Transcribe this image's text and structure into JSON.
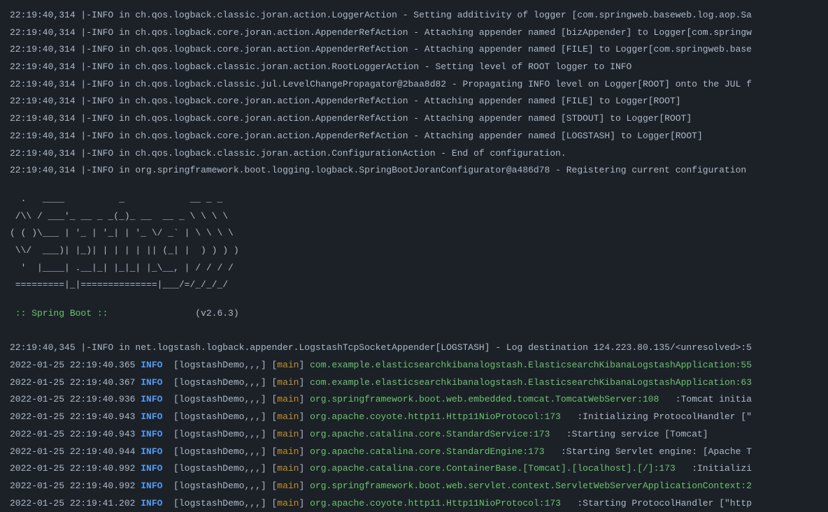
{
  "plainLogs": [
    "22:19:40,314 |-INFO in ch.qos.logback.classic.joran.action.LoggerAction - Setting additivity of logger [com.springweb.baseweb.log.aop.Sa",
    "22:19:40,314 |-INFO in ch.qos.logback.core.joran.action.AppenderRefAction - Attaching appender named [bizAppender] to Logger[com.springw",
    "22:19:40,314 |-INFO in ch.qos.logback.core.joran.action.AppenderRefAction - Attaching appender named [FILE] to Logger[com.springweb.base",
    "22:19:40,314 |-INFO in ch.qos.logback.classic.joran.action.RootLoggerAction - Setting level of ROOT logger to INFO",
    "22:19:40,314 |-INFO in ch.qos.logback.classic.jul.LevelChangePropagator@2baa8d82 - Propagating INFO level on Logger[ROOT] onto the JUL f",
    "22:19:40,314 |-INFO in ch.qos.logback.core.joran.action.AppenderRefAction - Attaching appender named [FILE] to Logger[ROOT]",
    "22:19:40,314 |-INFO in ch.qos.logback.core.joran.action.AppenderRefAction - Attaching appender named [STDOUT] to Logger[ROOT]",
    "22:19:40,314 |-INFO in ch.qos.logback.core.joran.action.AppenderRefAction - Attaching appender named [LOGSTASH] to Logger[ROOT]",
    "22:19:40,314 |-INFO in ch.qos.logback.classic.joran.action.ConfigurationAction - End of configuration.",
    "22:19:40,314 |-INFO in org.springframework.boot.logging.logback.SpringBootJoranConfigurator@a486d78 - Registering current configuration "
  ],
  "banner": "  .   ____          _            __ _ _\n /\\\\ / ___'_ __ _ _(_)_ __  __ _ \\ \\ \\ \\\n( ( )\\___ | '_ | '_| | '_ \\/ _` | \\ \\ \\ \\\n \\\\/  ___)| |_)| | | | | || (_| |  ) ) ) )\n  '  |____| .__|_| |_|_| |_\\__, | / / / /\n =========|_|==============|___/=/_/_/_/",
  "springBootTag": " :: Spring Boot :: ",
  "springBootVersion": "               (v2.6.3)",
  "logstashLine": "22:19:40,345 |-INFO in net.logstash.logback.appender.LogstashTcpSocketAppender[LOGSTASH] - Log destination 124.223.80.135/<unresolved>:5",
  "coloredLogs": [
    {
      "ts": "2022-01-25 22:19:40.365 ",
      "level": "INFO ",
      "app": " [logstashDemo,,,] [",
      "thread": "main",
      "logger": "com.example.elasticsearchkibanalogstash.ElasticsearchKibanaLogstashApplication:55"
    },
    {
      "ts": "2022-01-25 22:19:40.367 ",
      "level": "INFO ",
      "app": " [logstashDemo,,,] [",
      "thread": "main",
      "logger": "com.example.elasticsearchkibanalogstash.ElasticsearchKibanaLogstashApplication:63"
    },
    {
      "ts": "2022-01-25 22:19:40.936 ",
      "level": "INFO ",
      "app": " [logstashDemo,,,] [",
      "thread": "main",
      "logger": "org.springframework.boot.web.embedded.tomcat.TomcatWebServer:108",
      "msg": "   :Tomcat initia"
    },
    {
      "ts": "2022-01-25 22:19:40.943 ",
      "level": "INFO ",
      "app": " [logstashDemo,,,] [",
      "thread": "main",
      "logger": "org.apache.coyote.http11.Http11NioProtocol:173",
      "msg": "   :Initializing ProtocolHandler [\""
    },
    {
      "ts": "2022-01-25 22:19:40.943 ",
      "level": "INFO ",
      "app": " [logstashDemo,,,] [",
      "thread": "main",
      "logger": "org.apache.catalina.core.StandardService:173",
      "msg": "   :Starting service [Tomcat]"
    },
    {
      "ts": "2022-01-25 22:19:40.944 ",
      "level": "INFO ",
      "app": " [logstashDemo,,,] [",
      "thread": "main",
      "logger": "org.apache.catalina.core.StandardEngine:173",
      "msg": "   :Starting Servlet engine: [Apache T"
    },
    {
      "ts": "2022-01-25 22:19:40.992 ",
      "level": "INFO ",
      "app": " [logstashDemo,,,] [",
      "thread": "main",
      "logger": "org.apache.catalina.core.ContainerBase.[Tomcat].[localhost].[/]:173",
      "msg": "   :Initializi"
    },
    {
      "ts": "2022-01-25 22:19:40.992 ",
      "level": "INFO ",
      "app": " [logstashDemo,,,] [",
      "thread": "main",
      "logger": "org.springframework.boot.web.servlet.context.ServletWebServerApplicationContext:2"
    },
    {
      "ts": "2022-01-25 22:19:41.202 ",
      "level": "INFO ",
      "app": " [logstashDemo,,,] [",
      "thread": "main",
      "logger": "org.apache.coyote.http11.Http11NioProtocol:173",
      "msg": "   :Starting ProtocolHandler [\"http"
    }
  ]
}
